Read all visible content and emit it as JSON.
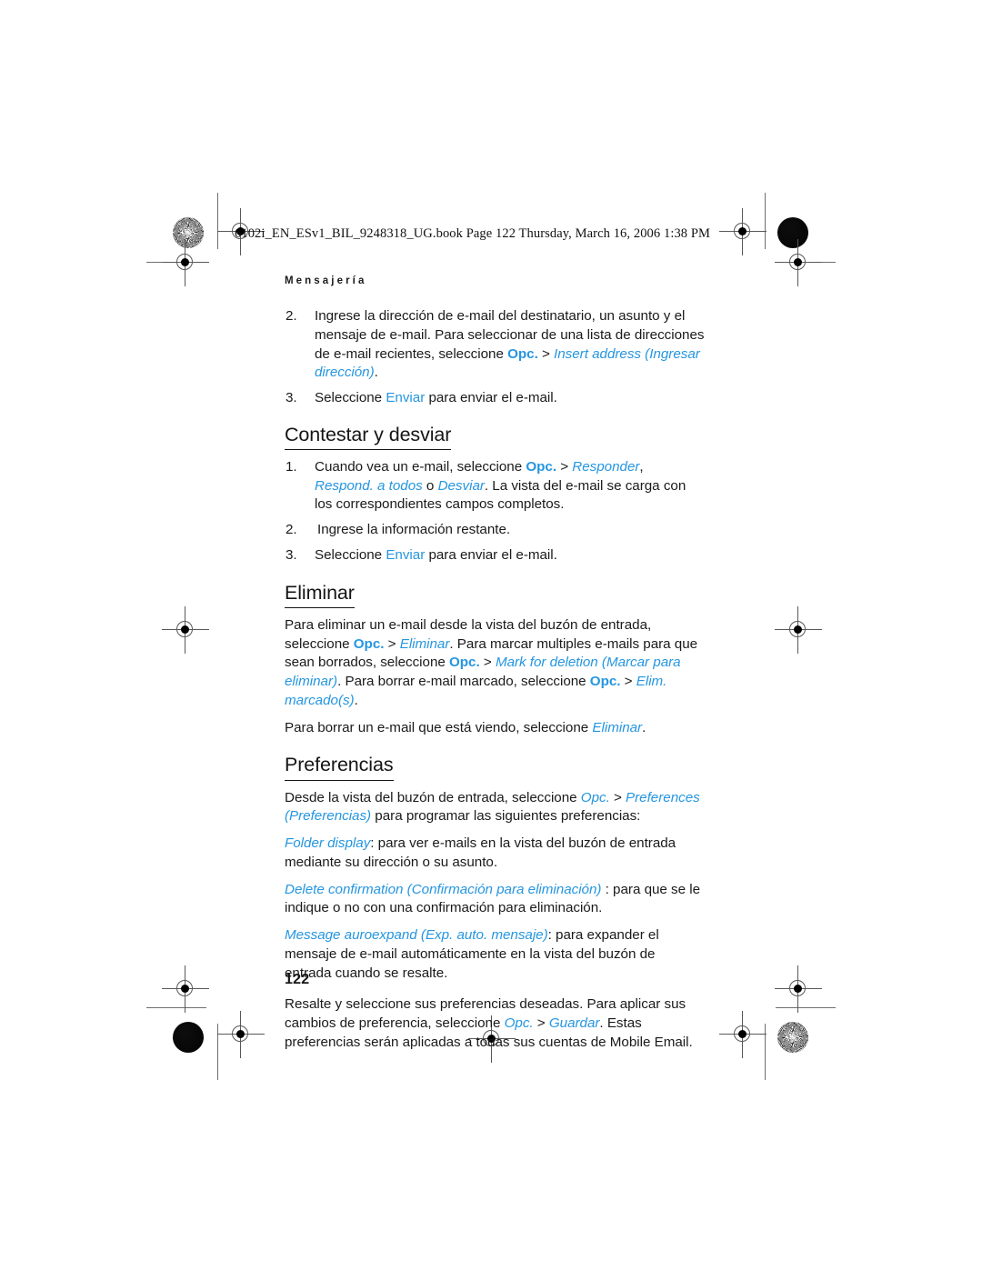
{
  "document": {
    "file_slug": "6102i_EN_ESv1_BIL_9248318_UG.book  Page 122  Thursday, March 16, 2006  1:38 PM",
    "chapter_header": "Mensajería",
    "page_number": "122",
    "accent_color": "#2596e0",
    "text_color": "#1a1a1a"
  },
  "intro_steps": {
    "step2": {
      "num": "2.",
      "t1": "Ingrese la dirección de e-mail del destinatario, un asunto y el mensaje de e-mail. Para seleccionar de una lista de direcciones de e-mail recientes, seleccione ",
      "opc": "Opc.",
      "gt": " > ",
      "t2": "Insert address (Ingresar dirección)",
      "t3": "."
    },
    "step3": {
      "num": "3.",
      "t1": "Seleccione ",
      "enviar": "Enviar",
      "t2": " para enviar el e-mail."
    }
  },
  "section_reply": {
    "heading": "Contestar y desviar",
    "step1": {
      "num": "1.",
      "t1": "Cuando vea un e-mail, seleccione ",
      "opc": "Opc.",
      "gt": " > ",
      "i1": "Responder",
      "sep1": ", ",
      "i2": "Respond. a todos",
      "sep2": " o ",
      "i3": "Desviar",
      "t2": ". La vista del e-mail se carga con los correspondientes campos completos."
    },
    "step2": {
      "num": "2.",
      "t1": "Ingrese la información restante."
    },
    "step3": {
      "num": "3.",
      "t1": "Seleccione ",
      "enviar": "Enviar",
      "t2": " para enviar el e-mail."
    }
  },
  "section_delete": {
    "heading": "Eliminar",
    "para1": {
      "t1": "Para eliminar un e-mail desde la vista del buzón de entrada, seleccione ",
      "opc1": "Opc.",
      "gt1": " > ",
      "i1": "Eliminar",
      "t2": ". Para marcar multiples e-mails para que sean borrados, seleccione ",
      "opc2": "Opc.",
      "gt2": " > ",
      "i2": "Mark for deletion (Marcar para eliminar)",
      "t3": ". Para borrar e-mail marcado, seleccione ",
      "opc3": "Opc.",
      "gt3": " > ",
      "i3": "Elim. marcado(s)",
      "t4": "."
    },
    "para2": {
      "t1": "Para borrar un e-mail que está viendo, seleccione ",
      "i1": "Eliminar",
      "t2": "."
    }
  },
  "section_preferences": {
    "heading": "Preferencias",
    "para1": {
      "t1": "Desde la vista del buzón de entrada, seleccione ",
      "i1": "Opc.",
      "gt": " > ",
      "i2": "Preferences (Preferencias)",
      "t2": " para programar las siguientes preferencias:"
    },
    "para2": {
      "i1": "Folder display",
      "t1": ": para ver e-mails en la vista del buzón de entrada mediante su dirección o su asunto."
    },
    "para3": {
      "i1": "Delete confirmation (Confirmación para eliminación)",
      "t1": " : para que se le indique o no con una confirmación para eliminación."
    },
    "para4": {
      "i1": "Message auroexpand (Exp. auto. mensaje)",
      "t1": ": para expander el mensaje de e-mail automáticamente en la vista del buzón de entrada cuando se resalte."
    },
    "para5": {
      "t1": "Resalte y seleccione sus preferencias deseadas. Para aplicar sus cambios de preferencia, seleccione ",
      "i1": "Opc.",
      "gt": " > ",
      "i2": "Guardar",
      "t2": ". Estas preferencias serán aplicadas a todas sus cuentas de Mobile Email."
    }
  }
}
